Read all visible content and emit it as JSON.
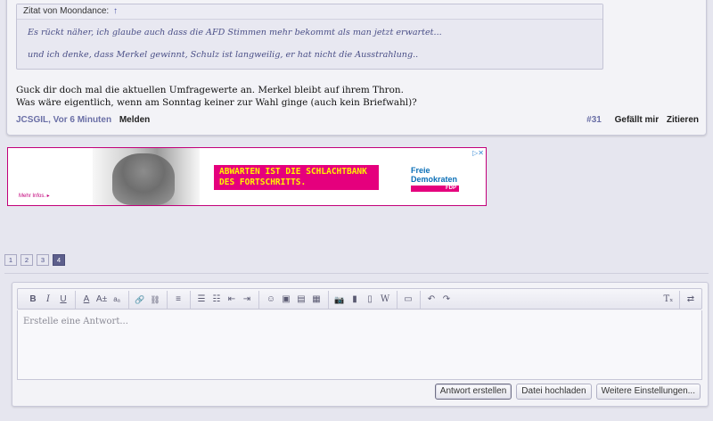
{
  "post": {
    "quote": {
      "header": "Zitat von Moondance:",
      "jump_icon": "↑",
      "lines": [
        "Es rückt näher, ich glaube auch dass die AFD Stimmen mehr bekommt als man jetzt erwartet...",
        "und ich denke, dass Merkel gewinnt, Schulz ist langweilig, er hat nicht die Ausstrahlung.."
      ]
    },
    "text_lines": [
      "Guck dir doch mal die aktuellen Umfragewerte an. Merkel bleibt auf ihrem Thron.",
      "Was wäre eigentlich, wenn am Sonntag keiner zur Wahl ginge (auch kein Briefwahl)?"
    ],
    "author": "JCSGIL",
    "time": ", Vor 6 Minuten",
    "report_label": "Melden",
    "post_number": "#31",
    "like_label": "Gefällt mir",
    "quote_label": "Zitieren"
  },
  "ad": {
    "slogan_line1": "ABWARTEN IST DIE SCHLACHTBANK",
    "slogan_line2": "DES FORTSCHRITTS.",
    "brand_line1": "Freie",
    "brand_line2": "Demokraten",
    "brand_tag": "FDP",
    "more_info": "Mehr Infos. ▸",
    "choice_icon": "ad-choices-icon",
    "choice_glyph": "▷✕"
  },
  "pagination": {
    "pages": [
      "1",
      "2",
      "3",
      "4"
    ],
    "active": "4"
  },
  "editor": {
    "toolbar": {
      "bold": "B",
      "italic": "I",
      "underline": "U",
      "font_color": "A",
      "font_size": "A±",
      "font_case": "aₐ",
      "link": "🔗",
      "unlink": "⛓",
      "align": "≡",
      "list_bullets": "☰",
      "list_numbers": "☷",
      "outdent": "⇤",
      "indent": "⇥",
      "smiley": "☺",
      "image": "▣",
      "gallery": "▤",
      "attach": "▦",
      "camera": "📷",
      "media": "▮",
      "page": "▯",
      "wiki": "W",
      "save": "▭",
      "undo": "↶",
      "redo": "↷",
      "clear_format": "Tₓ",
      "toggle_source": "⇄"
    },
    "placeholder": "Erstelle eine Antwort...",
    "buttons": {
      "submit": "Antwort erstellen",
      "upload": "Datei hochladen",
      "more": "Weitere Einstellungen..."
    }
  },
  "colors": {
    "background": "#e6e6ef",
    "accent": "#6a6fa6",
    "ad_magenta": "#e5007d",
    "ad_yellow": "#fff200",
    "fdp_blue": "#0a6fb7"
  }
}
